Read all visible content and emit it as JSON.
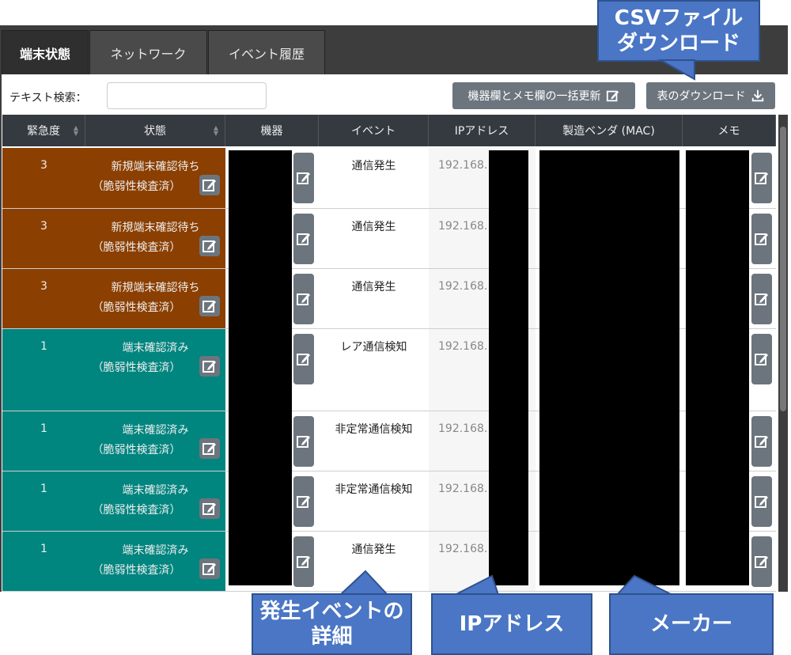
{
  "tabs": [
    {
      "label": "端末状態",
      "active": true
    },
    {
      "label": "ネットワーク",
      "active": false
    },
    {
      "label": "イベント履歴",
      "active": false
    }
  ],
  "toolbar": {
    "search_label": "テキスト検索：",
    "search_value": "",
    "bulk_update_label": "機器欄とメモ欄の一括更新",
    "download_label": "表のダウンロード"
  },
  "columns": [
    "緊急度",
    "状態",
    "機器",
    "イベント",
    "IPアドレス",
    "製造ベンダ (MAC)",
    "メモ"
  ],
  "rows": [
    {
      "severity": "3",
      "state1": "新規端末確認待ち",
      "state2": "（脆弱性検査済）",
      "event": "通信発生",
      "ip": "192.168."
    },
    {
      "severity": "3",
      "state1": "新規端末確認待ち",
      "state2": "（脆弱性検査済）",
      "event": "通信発生",
      "ip": "192.168."
    },
    {
      "severity": "3",
      "state1": "新規端末確認待ち",
      "state2": "（脆弱性検査済）",
      "event": "通信発生",
      "ip": "192.168."
    },
    {
      "severity": "1",
      "state1": "端末確認済み",
      "state2": "（脆弱性検査済）",
      "event": "レア通信検知",
      "ip": "192.168."
    },
    {
      "severity": "1",
      "state1": "端末確認済み",
      "state2": "（脆弱性検査済）",
      "event": "非定常通信検知",
      "ip": "192.168."
    },
    {
      "severity": "1",
      "state1": "端末確認済み",
      "state2": "（脆弱性検査済）",
      "event": "非定常通信検知",
      "ip": "192.168."
    },
    {
      "severity": "1",
      "state1": "端末確認済み",
      "state2": "（脆弱性検査済）",
      "event": "通信発生",
      "ip": "192.168."
    }
  ],
  "callouts": {
    "csv_line1": "CSVファイル",
    "csv_line2": "ダウンロード",
    "event_line1": "発生イベントの",
    "event_line2": "詳細",
    "ip": "IPアドレス",
    "maker": "メーカー"
  },
  "colors": {
    "severity3": "#8b3f00",
    "severity1": "#00857f",
    "header": "#343a40",
    "button": "#6c757d",
    "callout": "#4a76c5"
  },
  "icons": {
    "edit": "edit-icon",
    "download": "download-icon",
    "sort": "sort-icon"
  }
}
